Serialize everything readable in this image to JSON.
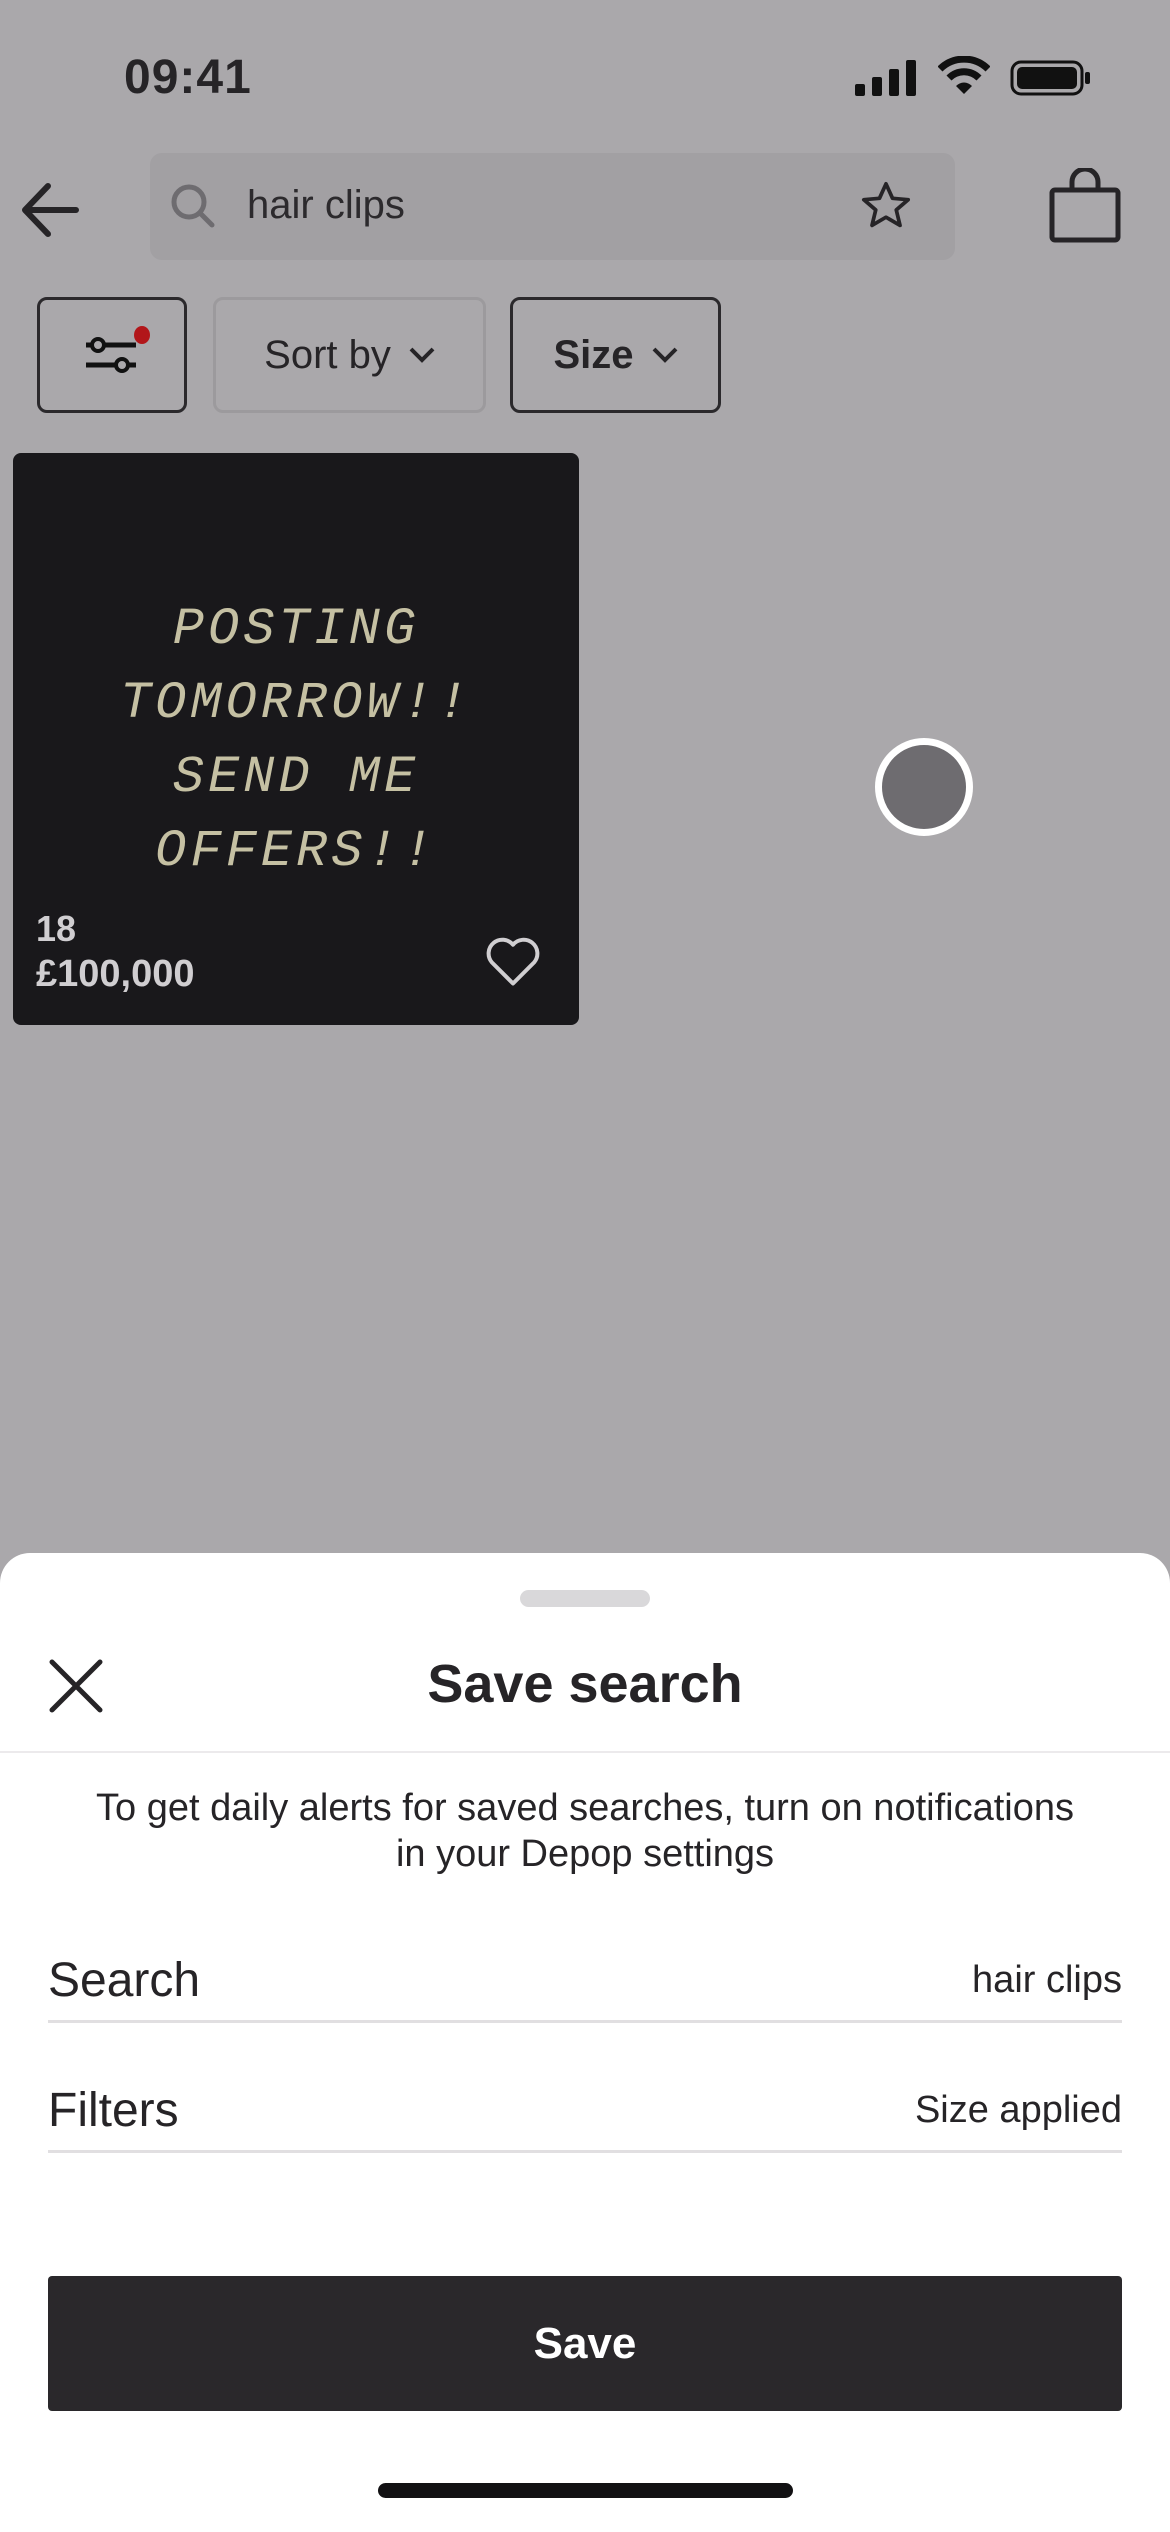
{
  "status_bar": {
    "time": "09:41"
  },
  "header": {
    "search_value": "hair clips"
  },
  "filters": {
    "sort_label": "Sort by",
    "size_label": "Size",
    "filter_active": true,
    "accent_color": "#b2161a"
  },
  "product": {
    "image_text": "POSTING\nTOMORROW!!\nSEND ME\nOFFERS!!",
    "size": "18",
    "price": "£100,000"
  },
  "sheet": {
    "title": "Save search",
    "info": "To get daily alerts for saved searches, turn on notifications in your Depop settings",
    "rows": [
      {
        "label": "Search",
        "value": "hair clips"
      },
      {
        "label": "Filters",
        "value": "Size applied"
      }
    ],
    "save_label": "Save"
  }
}
